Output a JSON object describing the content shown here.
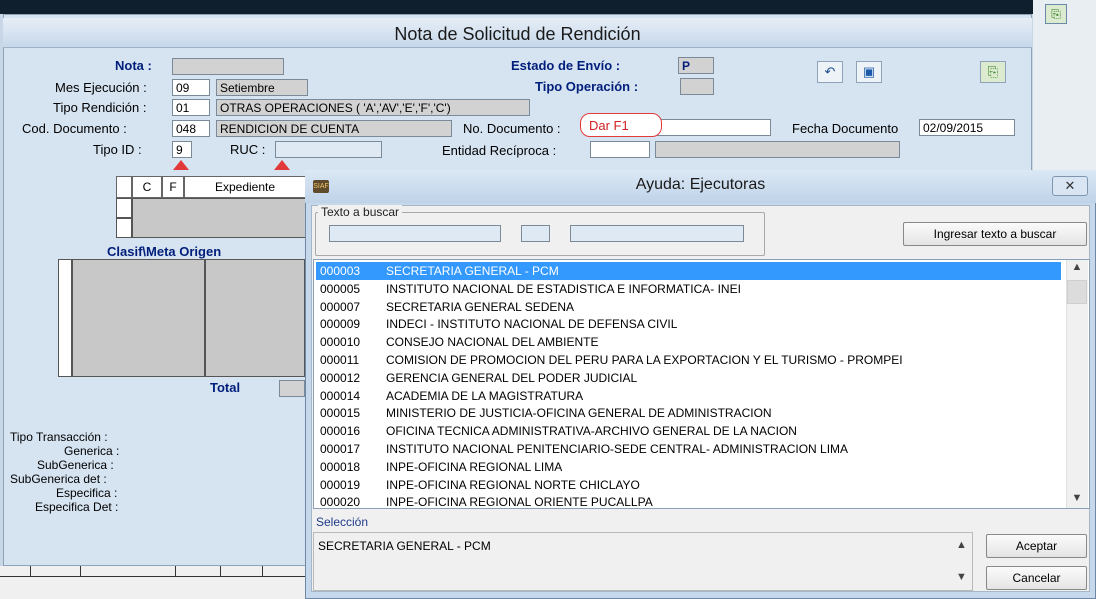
{
  "main_window": {
    "title": "Nota de Solicitud de Rendición",
    "nota_label": "Nota :",
    "mes_ejecucion_label": "Mes Ejecución :",
    "mes_ejecucion_code": "09",
    "mes_ejecucion_name": "Setiembre",
    "tipo_rendicion_label": "Tipo Rendición :",
    "tipo_rendicion_code": "01",
    "tipo_rendicion_name": "OTRAS OPERACIONES ( 'A','AV','E','F','C')",
    "cod_documento_label": "Cod. Documento :",
    "cod_documento_code": "048",
    "cod_documento_name": "RENDICION DE CUENTA",
    "tipo_id_label": "Tipo ID :",
    "tipo_id_value": "9",
    "ruc_label": "RUC :",
    "estado_envio_label": "Estado de Envío :",
    "estado_envio_value": "P",
    "tipo_operacion_label": "Tipo Operación :",
    "no_documento_label": "No. Documento :",
    "no_documento_callout": "Dar F1",
    "fecha_documento_label": "Fecha Documento",
    "fecha_documento_value": "02/09/2015",
    "entidad_reciproca_label": "Entidad Recíproca :",
    "grid_headers": [
      "C",
      "F",
      "Expediente"
    ],
    "clasif_meta_label": "Clasif\\Meta Origen",
    "total_label": "Total",
    "detail_labels": [
      "Tipo Transacción :",
      "Generica :",
      "SubGenerica :",
      "SubGenerica det :",
      "Especifica :",
      "Especifica Det :"
    ]
  },
  "dialog": {
    "title": "Ayuda: Ejecutoras",
    "close_glyph": "✕",
    "search_group_label": "Texto a buscar",
    "search_button": "Ingresar texto a buscar",
    "items": [
      {
        "code": "000003",
        "name": "SECRETARIA GENERAL - PCM"
      },
      {
        "code": "000005",
        "name": "INSTITUTO NACIONAL DE ESTADISTICA E INFORMATICA- INEI"
      },
      {
        "code": "000007",
        "name": "SECRETARIA GENERAL SEDENA"
      },
      {
        "code": "000009",
        "name": "INDECI - INSTITUTO NACIONAL DE DEFENSA CIVIL"
      },
      {
        "code": "000010",
        "name": "CONSEJO NACIONAL DEL AMBIENTE"
      },
      {
        "code": "000011",
        "name": "COMISION DE PROMOCION DEL PERU PARA LA EXPORTACION Y EL TURISMO - PROMPEI"
      },
      {
        "code": "000012",
        "name": "GERENCIA GENERAL DEL PODER JUDICIAL"
      },
      {
        "code": "000014",
        "name": "ACADEMIA DE LA MAGISTRATURA"
      },
      {
        "code": "000015",
        "name": "MINISTERIO DE JUSTICIA-OFICINA GENERAL DE ADMINISTRACION"
      },
      {
        "code": "000016",
        "name": "OFICINA TECNICA ADMINISTRATIVA-ARCHIVO GENERAL DE LA NACION"
      },
      {
        "code": "000017",
        "name": "INSTITUTO NACIONAL PENITENCIARIO-SEDE CENTRAL- ADMINISTRACION LIMA"
      },
      {
        "code": "000018",
        "name": "INPE-OFICINA REGIONAL LIMA"
      },
      {
        "code": "000019",
        "name": "INPE-OFICINA REGIONAL NORTE CHICLAYO"
      },
      {
        "code": "000020",
        "name": "INPE-OFICINA REGIONAL ORIENTE PUCALLPA"
      }
    ],
    "selected_index": 0,
    "seleccion_label": "Selección",
    "seleccion_value": "SECRETARIA GENERAL - PCM",
    "accept_button": "Aceptar",
    "cancel_button": "Cancelar"
  },
  "colors": {
    "selection": "#3399ff",
    "title_bold": "#001e7a",
    "callout_red": "#e23a3a"
  }
}
